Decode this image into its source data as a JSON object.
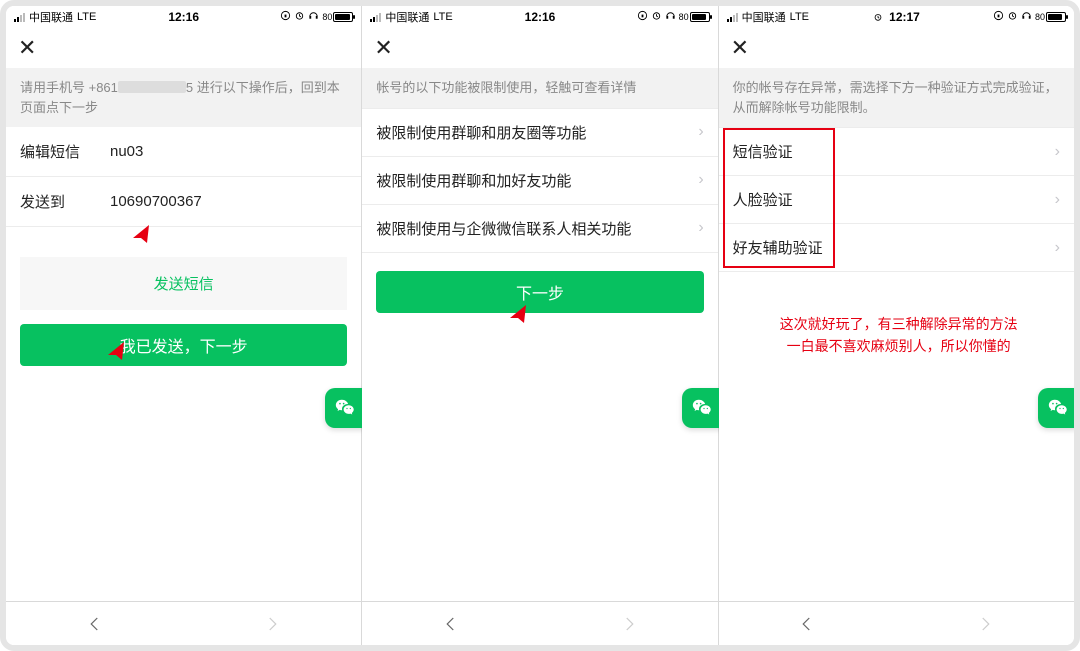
{
  "statusbar": {
    "carrier": "中国联通",
    "network": "LTE",
    "time_a": "12:16",
    "time_b": "12:16",
    "time_c": "12:17",
    "battery": "80"
  },
  "screen1": {
    "notice_prefix": "请用手机号 +861",
    "notice_suffix": "5 进行以下操作后，回到本页面点下一步",
    "row1_label": "编辑短信",
    "row1_value": "nu03",
    "row2_label": "发送到",
    "row2_value": "10690700367",
    "link_label": "发送短信",
    "btn_label": "我已发送，下一步"
  },
  "screen2": {
    "notice": "帐号的以下功能被限制使用，轻触可查看详情",
    "items": [
      "被限制使用群聊和朋友圈等功能",
      "被限制使用群聊和加好友功能",
      "被限制使用与企微微信联系人相关功能"
    ],
    "btn_label": "下一步"
  },
  "screen3": {
    "notice": "你的帐号存在异常，需选择下方一种验证方式完成验证，从而解除帐号功能限制。",
    "items": [
      "短信验证",
      "人脸验证",
      "好友辅助验证"
    ],
    "anno": "这次就好玩了，有三种解除异常的方法\n一白最不喜欢麻烦别人，所以你懂的"
  },
  "icons": {
    "close": "close-icon",
    "back": "chevron-left-icon",
    "forward": "chevron-right-icon",
    "wechat": "wechat-icon",
    "alarm": "alarm-icon",
    "headphone": "headphone-icon",
    "lock": "lock-icon",
    "clock": "clock-icon"
  }
}
